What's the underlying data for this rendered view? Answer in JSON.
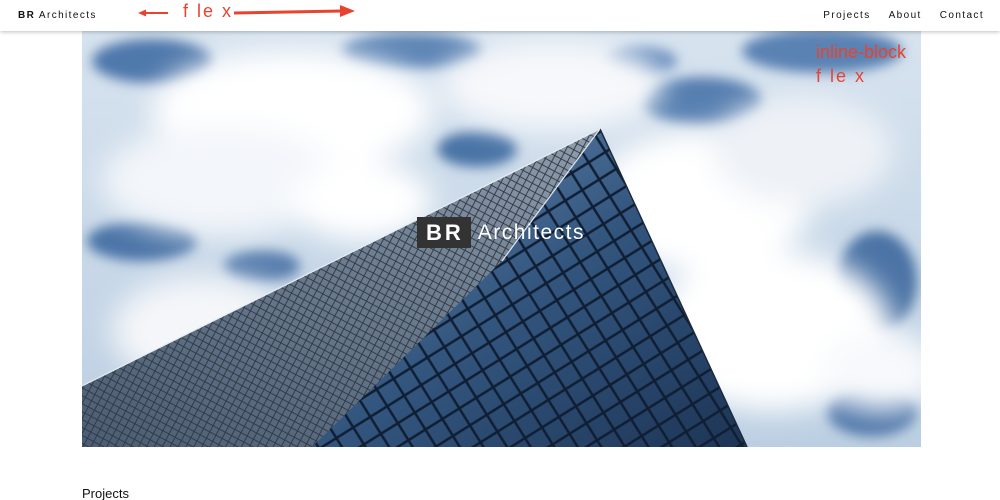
{
  "navbar": {
    "logo_bold": "BR",
    "logo_rest": "Architects",
    "links": [
      "Projects",
      "About",
      "Contact"
    ]
  },
  "hero": {
    "badge": "BR",
    "name": "Architects"
  },
  "annotations": {
    "top_label": "f le x",
    "right_line1": "inline-block",
    "right_line2": "f le x",
    "color": "#e8432f"
  },
  "sections": {
    "projects_heading": "Projects"
  }
}
